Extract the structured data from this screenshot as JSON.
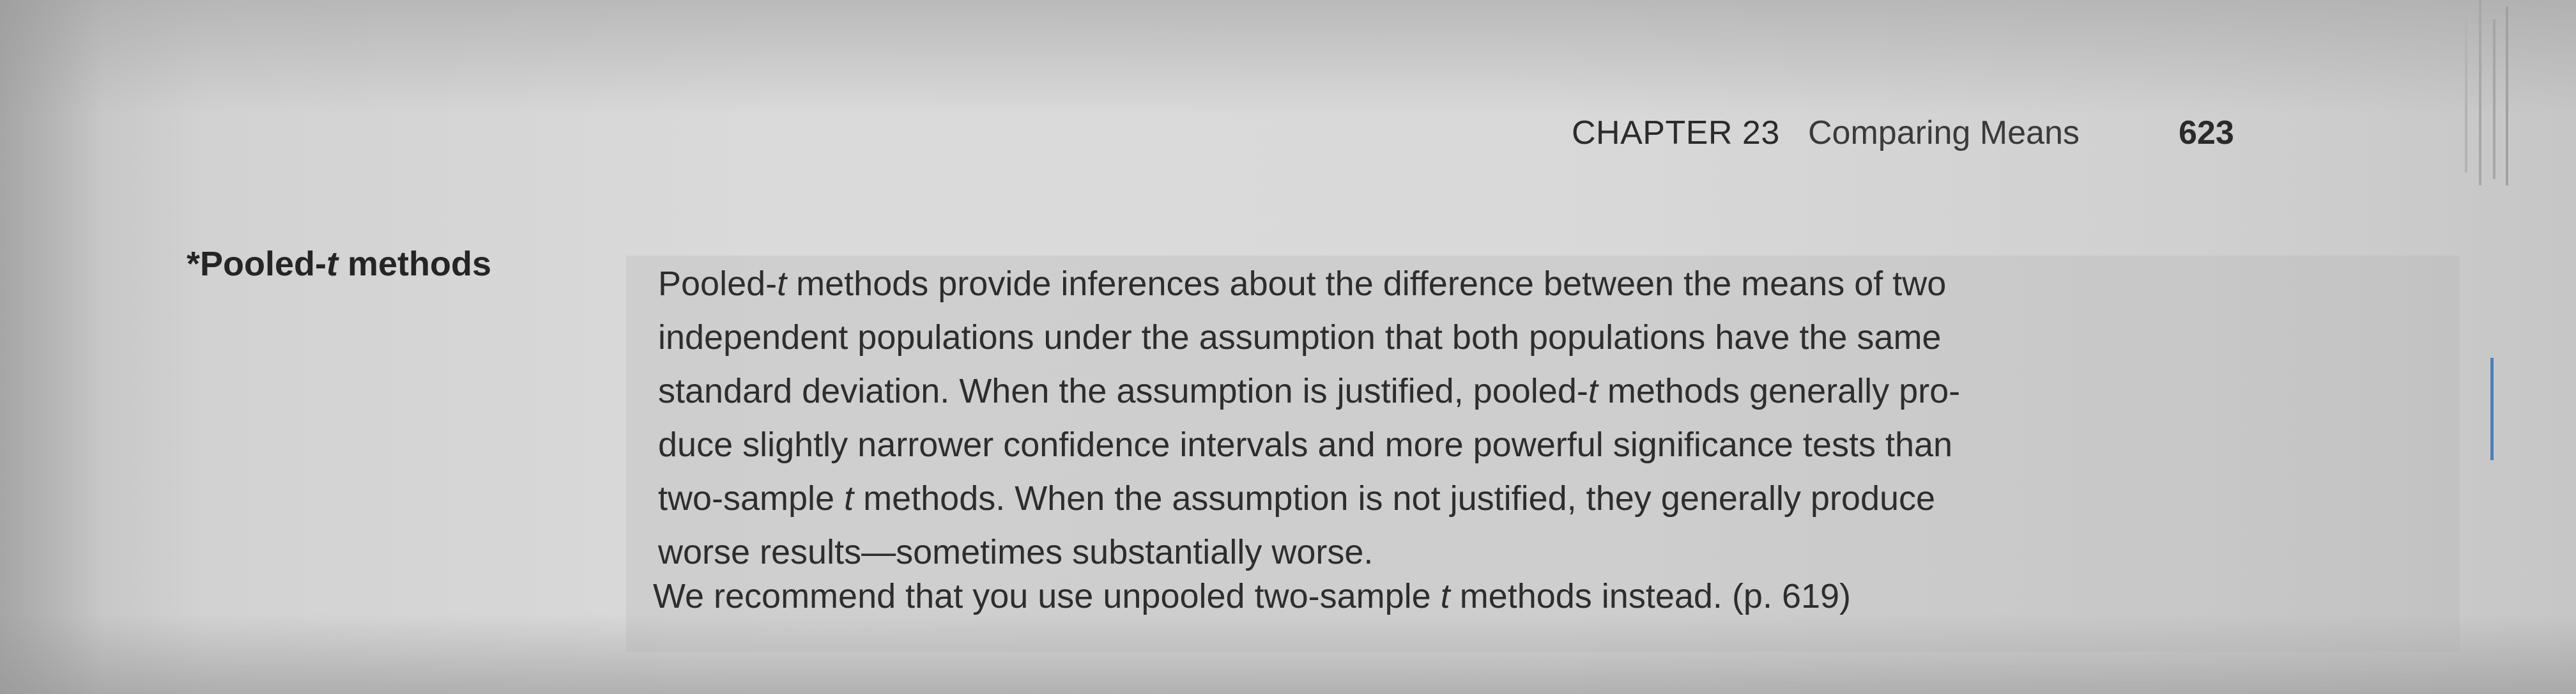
{
  "running_header": {
    "chapter": "CHAPTER 23",
    "title": "Comparing Means",
    "page_number": "623"
  },
  "entry": {
    "term_prefix": "*Pooled-",
    "term_italic": "t",
    "term_suffix": " methods",
    "definition_lines": [
      {
        "before": "Pooled-",
        "italic": "t",
        "after": " methods provide inferences about the difference between the means of two"
      },
      {
        "before": "independent populations under the assumption that both populations have the same",
        "italic": "",
        "after": ""
      },
      {
        "before": "standard deviation. When the assumption is justified, pooled-",
        "italic": "t",
        "after": " methods generally pro-"
      },
      {
        "before": "duce slightly narrower confidence intervals and more powerful significance tests than",
        "italic": "",
        "after": ""
      },
      {
        "before": "two-sample ",
        "italic": "t",
        "after": " methods. When the assumption is not justified, they generally produce"
      },
      {
        "before": "worse results—sometimes substantially worse.",
        "italic": "",
        "after": ""
      }
    ],
    "recommendation_before": "We recommend that you use unpooled two-sample ",
    "recommendation_italic": "t",
    "recommendation_after": " methods instead. (p. 619)"
  }
}
